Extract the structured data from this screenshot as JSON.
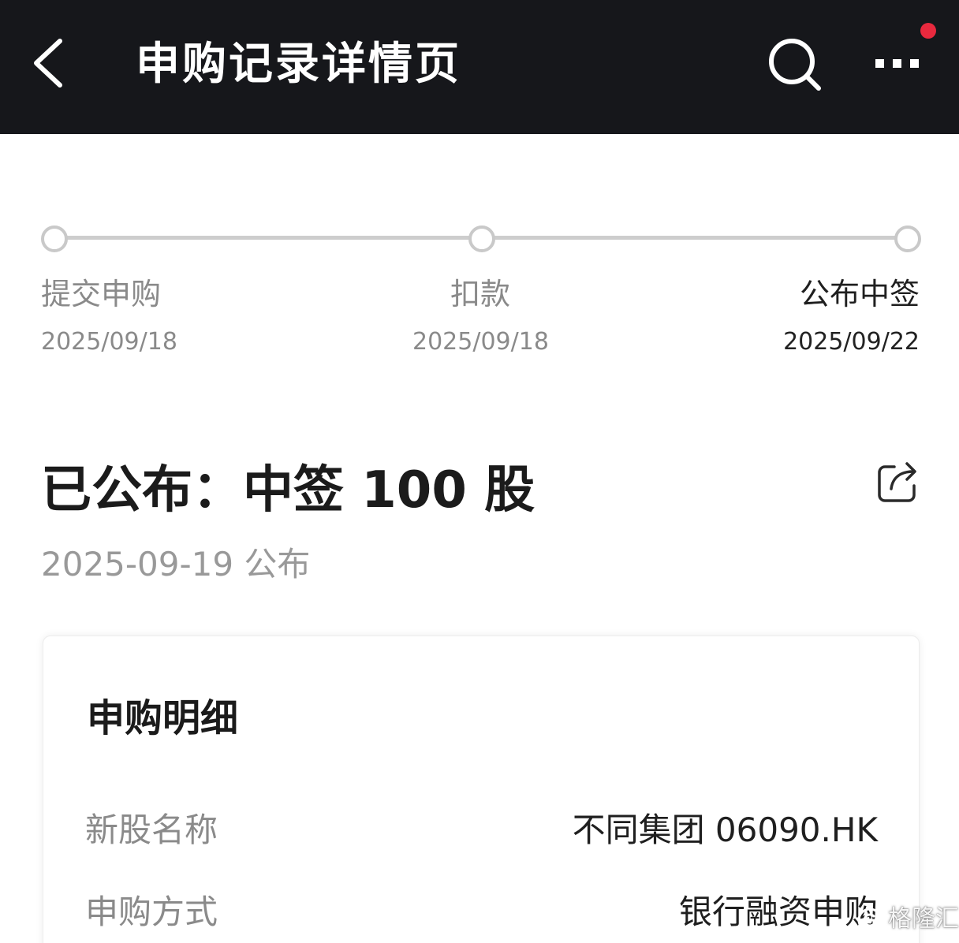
{
  "header": {
    "title": "申购记录详情页",
    "back_icon": "chevron-left-icon",
    "search_icon": "search-icon",
    "more_icon": "more-horizontal-icon",
    "background_color": "#16171b",
    "notification_dot_color": "#e8293e"
  },
  "progress": {
    "steps": [
      {
        "label": "提交申购",
        "date": "2025/09/18",
        "active": false
      },
      {
        "label": "扣款",
        "date": "2025/09/18",
        "active": false
      },
      {
        "label": "公布中签",
        "date": "2025/09/22",
        "active": true
      }
    ]
  },
  "result": {
    "title": "已公布：中签 100 股",
    "date": "2025-09-19 公布",
    "share_icon": "share-icon"
  },
  "detail": {
    "title": "申购明细",
    "rows": [
      {
        "label": "新股名称",
        "value": "不同集团 06090.HK"
      },
      {
        "label": "申购方式",
        "value": "银行融资申购"
      }
    ]
  },
  "watermark": {
    "text": "格隆汇"
  }
}
